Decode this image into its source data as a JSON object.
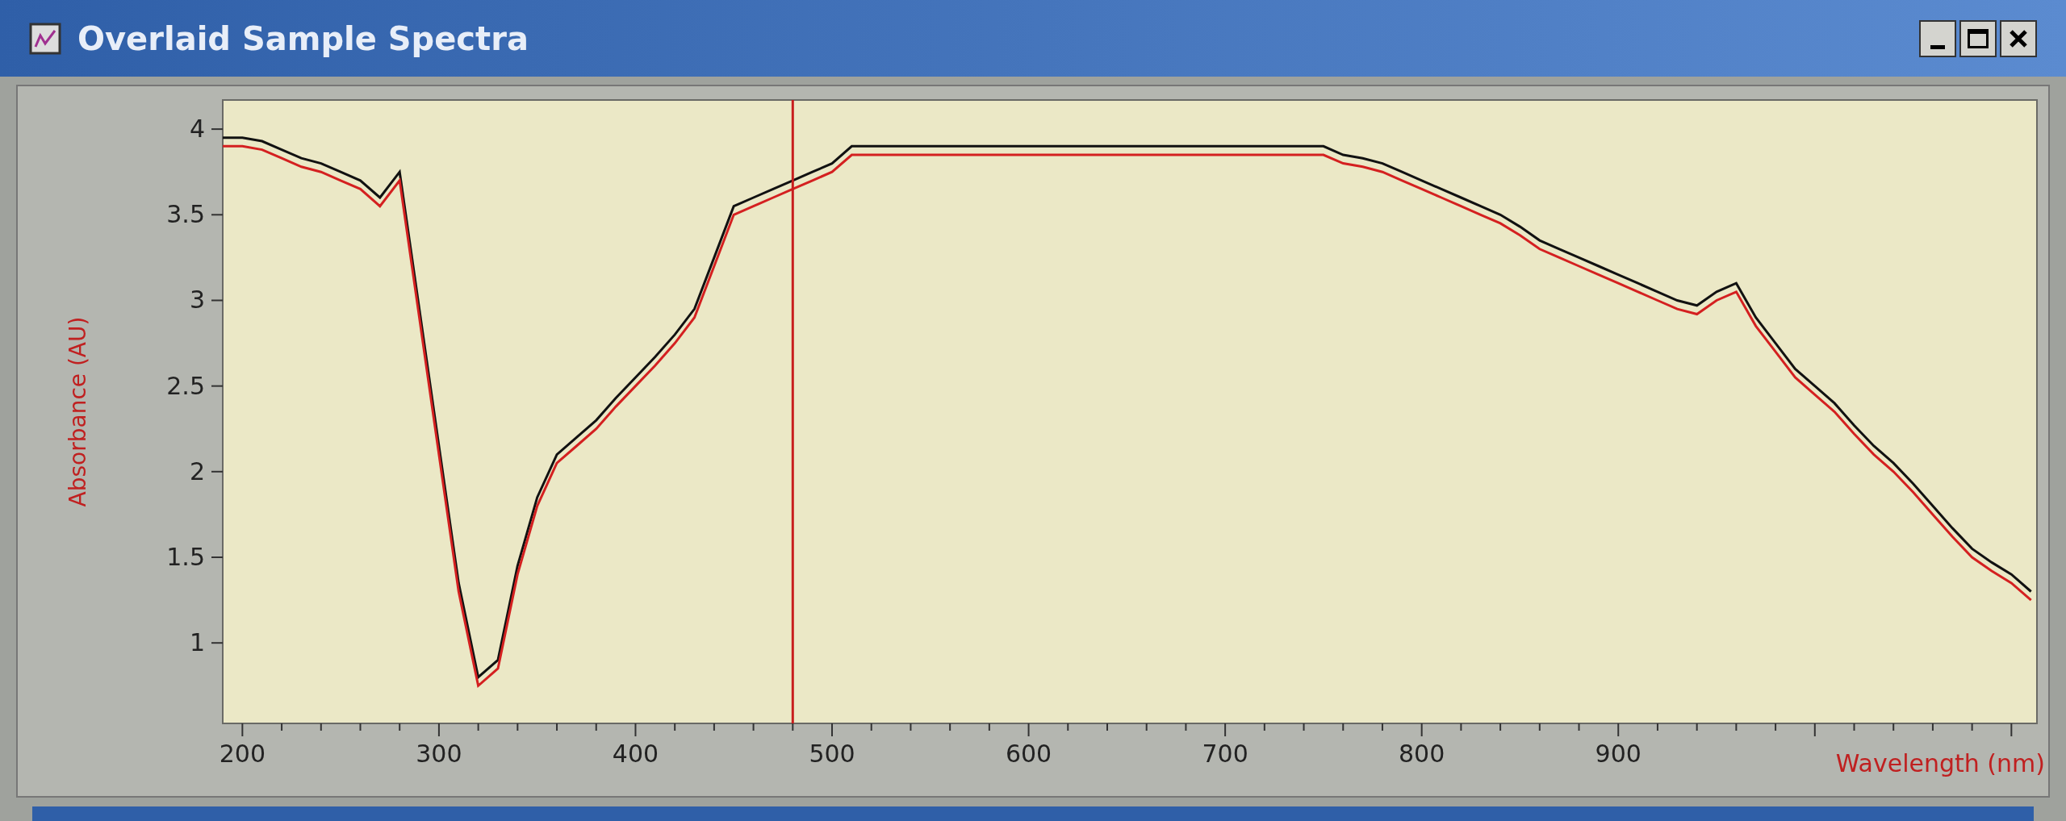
{
  "window": {
    "title": "Overlaid Sample Spectra"
  },
  "chart": {
    "chart_data": {
      "type": "line",
      "xlabel": "Wavelength (nm)",
      "ylabel": "Absorbance (AU)",
      "xlim": [
        190,
        1113
      ],
      "ylim": [
        0.53,
        4.17
      ],
      "xticks": [
        200,
        300,
        400,
        500,
        600,
        700,
        800,
        900
      ],
      "yticks": [
        1,
        1.5,
        2,
        2.5,
        3,
        3.5,
        4
      ],
      "x": [
        190,
        200,
        210,
        220,
        230,
        240,
        250,
        260,
        270,
        280,
        290,
        300,
        310,
        320,
        330,
        340,
        350,
        360,
        370,
        380,
        390,
        400,
        410,
        420,
        430,
        440,
        450,
        460,
        470,
        480,
        490,
        500,
        510,
        520,
        530,
        540,
        550,
        560,
        570,
        580,
        590,
        600,
        610,
        620,
        630,
        640,
        650,
        660,
        670,
        680,
        690,
        700,
        710,
        720,
        730,
        740,
        750,
        760,
        770,
        780,
        790,
        800,
        810,
        820,
        830,
        840,
        850,
        860,
        870,
        880,
        890,
        900,
        910,
        920,
        930,
        940,
        950,
        960,
        970,
        980,
        990,
        1000,
        1010,
        1020,
        1030,
        1040,
        1050,
        1060,
        1070,
        1080,
        1090,
        1100,
        1110
      ],
      "series": [
        {
          "color": "#111111",
          "values": [
            3.95,
            3.95,
            3.93,
            3.88,
            3.83,
            3.8,
            3.75,
            3.7,
            3.6,
            3.75,
            2.95,
            2.15,
            1.35,
            0.8,
            0.9,
            1.45,
            1.85,
            2.1,
            2.2,
            2.3,
            2.43,
            2.55,
            2.67,
            2.8,
            2.95,
            3.25,
            3.55,
            3.6,
            3.65,
            3.7,
            3.75,
            3.8,
            3.9,
            3.9,
            3.9,
            3.9,
            3.9,
            3.9,
            3.9,
            3.9,
            3.9,
            3.9,
            3.9,
            3.9,
            3.9,
            3.9,
            3.9,
            3.9,
            3.9,
            3.9,
            3.9,
            3.9,
            3.9,
            3.9,
            3.9,
            3.9,
            3.9,
            3.85,
            3.83,
            3.8,
            3.75,
            3.7,
            3.65,
            3.6,
            3.55,
            3.5,
            3.43,
            3.35,
            3.3,
            3.25,
            3.2,
            3.15,
            3.1,
            3.05,
            3.0,
            2.97,
            3.05,
            3.1,
            2.9,
            2.75,
            2.6,
            2.5,
            2.4,
            2.27,
            2.15,
            2.05,
            1.93,
            1.8,
            1.67,
            1.55,
            1.47,
            1.4,
            1.3
          ]
        },
        {
          "color": "#d42020",
          "values": [
            3.9,
            3.9,
            3.88,
            3.83,
            3.78,
            3.75,
            3.7,
            3.65,
            3.55,
            3.7,
            2.9,
            2.1,
            1.3,
            0.75,
            0.85,
            1.4,
            1.8,
            2.05,
            2.15,
            2.25,
            2.38,
            2.5,
            2.62,
            2.75,
            2.9,
            3.2,
            3.5,
            3.55,
            3.6,
            3.65,
            3.7,
            3.75,
            3.85,
            3.85,
            3.85,
            3.85,
            3.85,
            3.85,
            3.85,
            3.85,
            3.85,
            3.85,
            3.85,
            3.85,
            3.85,
            3.85,
            3.85,
            3.85,
            3.85,
            3.85,
            3.85,
            3.85,
            3.85,
            3.85,
            3.85,
            3.85,
            3.85,
            3.8,
            3.78,
            3.75,
            3.7,
            3.65,
            3.6,
            3.55,
            3.5,
            3.45,
            3.38,
            3.3,
            3.25,
            3.2,
            3.15,
            3.1,
            3.05,
            3.0,
            2.95,
            2.92,
            3.0,
            3.05,
            2.85,
            2.7,
            2.55,
            2.45,
            2.35,
            2.22,
            2.1,
            2.0,
            1.88,
            1.75,
            1.62,
            1.5,
            1.42,
            1.35,
            1.25
          ]
        }
      ],
      "ref_lines": [
        {
          "axis": "x",
          "value": 480,
          "color": "#c81e1e"
        }
      ]
    }
  }
}
